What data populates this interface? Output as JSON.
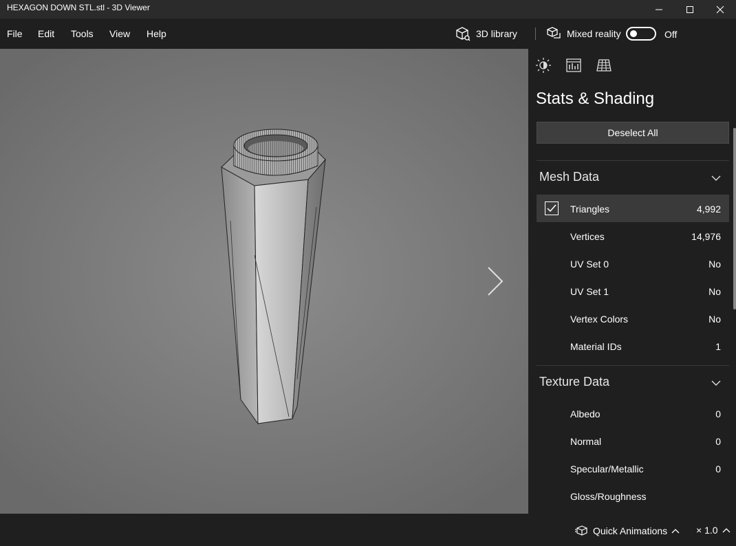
{
  "window": {
    "title": "HEXAGON DOWN STL.stl - 3D Viewer",
    "minimize_glyph": "—",
    "maximize_glyph": "☐",
    "close_glyph": "✕"
  },
  "menu": {
    "items": [
      "File",
      "Edit",
      "Tools",
      "View",
      "Help"
    ],
    "library_label": "3D library",
    "mixed_reality_label": "Mixed reality",
    "mixed_reality_state": "Off"
  },
  "panel": {
    "tabs": [
      {
        "icon": "lighting-icon",
        "active": false
      },
      {
        "icon": "stats-icon",
        "active": true
      },
      {
        "icon": "grid-icon",
        "active": false
      }
    ],
    "title": "Stats & Shading",
    "deselect_label": "Deselect All",
    "mesh_section": {
      "title": "Mesh Data",
      "rows": [
        {
          "label": "Triangles",
          "value": "4,992",
          "checked": true
        },
        {
          "label": "Vertices",
          "value": "14,976"
        },
        {
          "label": "UV Set 0",
          "value": "No"
        },
        {
          "label": "UV Set 1",
          "value": "No"
        },
        {
          "label": "Vertex Colors",
          "value": "No"
        },
        {
          "label": "Material IDs",
          "value": "1"
        }
      ]
    },
    "texture_section": {
      "title": "Texture Data",
      "rows": [
        {
          "label": "Albedo",
          "value": "0"
        },
        {
          "label": "Normal",
          "value": "0"
        },
        {
          "label": "Specular/Metallic",
          "value": "0"
        },
        {
          "label": "Gloss/Roughness",
          "value": ""
        }
      ]
    }
  },
  "bottom": {
    "quick_animations_label": "Quick Animations",
    "speed_label": "× 1.0"
  },
  "colors": {
    "background": "#1f1f1f",
    "titlebar": "#2b2b2b",
    "selected_row": "#3a3a3a",
    "button": "#3e3e3e"
  }
}
